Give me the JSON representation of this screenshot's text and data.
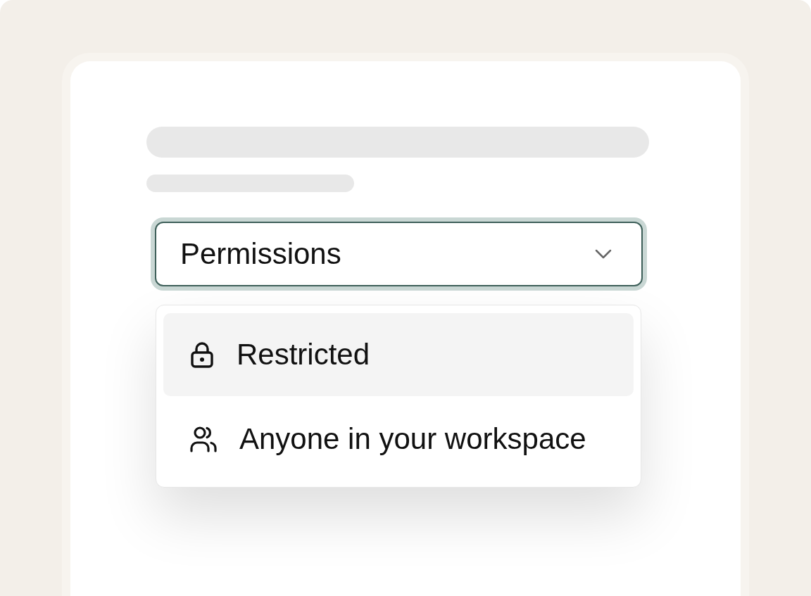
{
  "select": {
    "label": "Permissions",
    "expanded": true
  },
  "options": [
    {
      "kind": "restricted",
      "label": "Restricted",
      "selected": true
    },
    {
      "kind": "workspace",
      "label": "Anyone in your workspace",
      "selected": false
    }
  ]
}
